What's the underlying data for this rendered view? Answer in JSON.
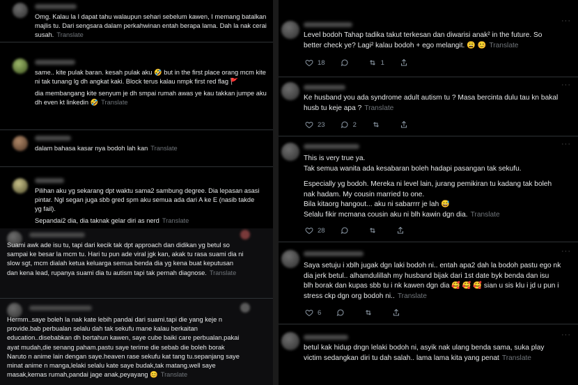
{
  "translate_label": "Translate",
  "left_posts": [
    {
      "text": "Omg. Kalau la I dapat tahu walaupun sehari sebelum kawen, I memang batalkan\nmajlis tu. Dari sengsara dalam perkahwinan entah berapa lama. Dah la nak cerai\nsusah."
    },
    {
      "text": "same.. kite pulak baran. kesah pulak aku 🤣 but in the first place orang mcm kite\nni tak tunang lg dh angkat kaki. Block terus kalau nmpk first red flag 🚩",
      "text2": "dia membangang kite senyum je dh smpai rumah awas ye kau takkan jumpe aku\ndh even kt linkedin 🤣"
    },
    {
      "text": "dalam bahasa kasar nya bodoh lah kan"
    },
    {
      "text": "Pilihan aku yg sekarang dpt waktu sama2 sambung degree. Dia lepasan asasi\npintar. Ngl segan juga sbb gred spm aku semua ada dari A ke E (nasib takde\nyg fail).",
      "text2": "Sepandai2 dia, dia taknak gelar diri as nerd"
    },
    {
      "text": "Suami awk ade isu tu, tapi dari kecik tak dpt approach dan didikan yg betul so\nsampai ke besar la mcm tu. Hari tu pun ade viral jgk kan, akak tu rasa suami dia ni\nslow sgt, mcm dialah ketua keluarga semua benda dia yg kena buat keputusan\ndan kena lead, rupanya suami dia tu autism tapi tak pernah diagnose."
    },
    {
      "text": "Hermm..saye boleh la nak kate lebih pandai dari suami.tapi die yang keje n\nprovide.bab perbualan selalu dah tak sekufu mane kalau berkaitan\neducation..disebabkan dh bertahun kawen, saye cube baiki care perbualan.pakai\nayat mudah,die senang paham.pastu saye terime die sebab die boleh borak\nNaruto n anime lain dengan saye.heaven rase sekufu kat tang tu.sepanjang saye\nminat anime n manga,lelaki selalu kate saye budak,tak matang.well saye\nmasak,kemas rumah,pandai jage anak,peyayang 😊"
    }
  ],
  "right_posts": [
    {
      "text": "Level bodoh Tahap tadika takut terkesan dan diwarisi anak² in the future. So\nbetter check ye? Lagi² kalau bodoh + ego melangit. 😩 😊",
      "likes": "18",
      "replies": "",
      "retweets": "1"
    },
    {
      "text": "Ke husband you ada syndrome adult autism tu ? Masa bercinta dulu tau kn bakal\nhusb tu keje apa ?",
      "likes": "23",
      "replies": "2",
      "retweets": ""
    },
    {
      "text": "This is very true ya.\nTak semua wanita ada kesabaran boleh hadapi pasangan tak sekufu.",
      "text2": "Especially yg bodoh. Mereka ni level lain, jurang pemikiran tu kadang tak boleh\nnak hadam. My cousin married to one.\nBila kitaorg hangout... aku ni sabarrrr je lah 😅\nSelalu fikir mcmana cousin aku ni blh kawin dgn dia.",
      "likes": "28",
      "replies": "",
      "retweets": ""
    },
    {
      "text": "Saya setuju i xblh jugak dgn laki bodoh ni.. entah apa2 dah la bodoh pastu ego nk\ndia jerk betul.. alhamdulillah my husband bijak dari 1st date byk benda dan isu\nblh borak dan kupas sbb tu i nk kawen dgn dia 🥰 🥰 🥰 sian u sis klu i jd u pun i\nstress ckp dgn org bodoh ni..",
      "likes": "6",
      "replies": "",
      "retweets": ""
    },
    {
      "text": "betul kak hidup dngn lelaki bodoh ni, asyik nak ulang benda sama, suka play\nvictim sedangkan diri tu dah salah.. lama lama kita yang penat"
    }
  ],
  "icons": [
    "heart-icon",
    "reply-icon",
    "retweet-icon",
    "bookmark-icon",
    "share-icon"
  ]
}
